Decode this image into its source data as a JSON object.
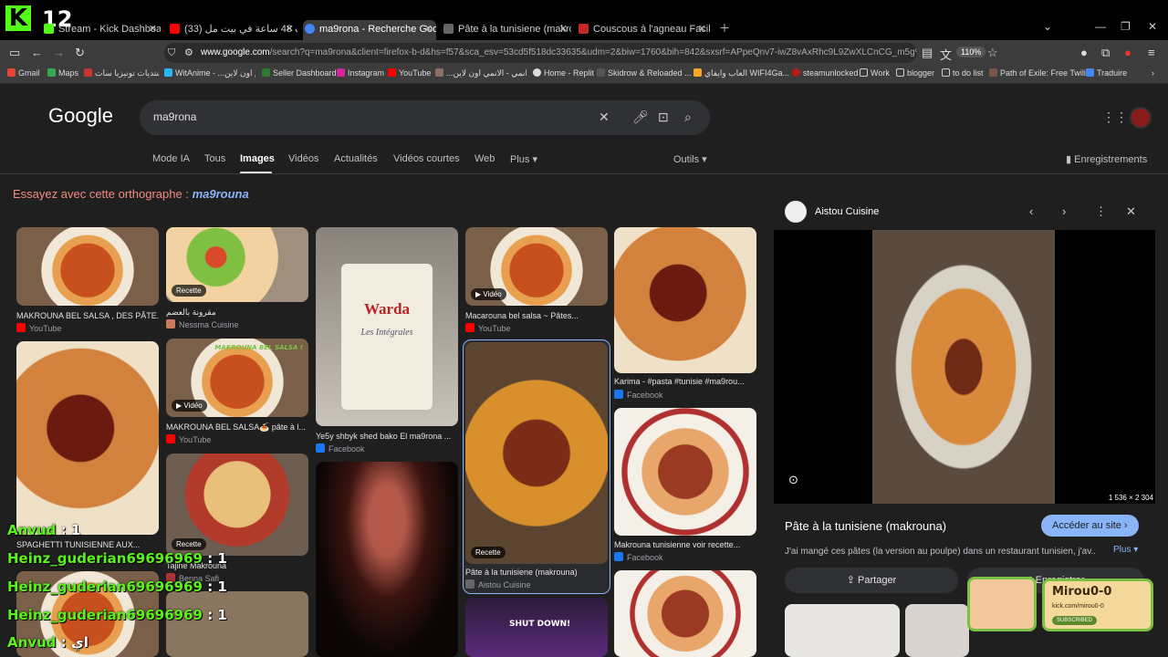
{
  "streamer": {
    "logo_letter": "K",
    "number": "12"
  },
  "tabs": [
    {
      "title": "Stream - Kick Dashboard",
      "color": "#53fc18"
    },
    {
      "title": "(33) عشت 48 ساعة في بيت مل...",
      "color": "#ff0000"
    },
    {
      "title": "ma9rona - Recherche Google",
      "color": "#4285f4"
    },
    {
      "title": "Pâte à la tunisiene (makrouna)",
      "color": "#666666"
    },
    {
      "title": "Couscous à l'agneau Facile et ra",
      "color": "#c62828"
    }
  ],
  "address": {
    "domain": "www.google.com",
    "rest": "/search?q=ma9rona&client=firefox-b-d&hs=f57&sca_esv=53cd5f518dc33635&udm=2&biw=1760&bih=842&sxsrf=APpeQnv7-iwZ8vAxRhc9L9ZwXLCnCG_m5g%3A178683447",
    "zoom": "110%"
  },
  "bookmarks": [
    "Gmail",
    "Maps",
    "منتديات تونيزيا سات",
    "WitAnime - ...م اون لاين",
    "Seller Dashboard",
    "Instagram",
    "YouTube",
    "...د انمي - الانمي اون لاين",
    "Home - Replit",
    "Skidrow & Reloaded ...",
    "العاب وايفاي WIFI4Ga...",
    "steamunlocked",
    "Work",
    "blogger",
    "to do list",
    "Path of Exile: Free Twili...",
    "Traduire"
  ],
  "google": {
    "logo": "Google",
    "query": "ma9rona"
  },
  "nav": [
    "Mode IA",
    "Tous",
    "Images",
    "Vidéos",
    "Actualités",
    "Vidéos courtes",
    "Web",
    "Plus"
  ],
  "tools": "Outils",
  "saved": "Enregistrements",
  "spell": {
    "prefix": "Essayez avec cette orthographe :",
    "suggestion": "ma9rouna"
  },
  "results": [
    {
      "caption": "MAKROUNA BEL SALSA , DES PÂTE...",
      "source": "YouTube"
    },
    {
      "caption": "مقرونة بالعضم",
      "source": "Nessma Cuisine",
      "badge": "Recette"
    },
    {
      "caption": "Ye5y shbyk shed bako El ma9rona ...",
      "source": "Facebook"
    },
    {
      "caption": "Macarouna bel salsa ~ Pâtes...",
      "source": "YouTube",
      "badge": "Vidéo"
    },
    {
      "caption": "Karima - #pasta #tunisie #ma9rou...",
      "source": "Facebook"
    },
    {
      "caption": "SPAGHETTI TUNISIENNE AUX...",
      "source": ""
    },
    {
      "caption": "MAKROUNA BEL SALSA🍝 pâte à l...",
      "source": "YouTube",
      "badge": "Vidéo"
    },
    {
      "caption": "Pâte à la tunisiene (makrouna)",
      "source": "Aistou Cuisine",
      "badge": "Recette"
    },
    {
      "caption": "Makrouna tunisienne voir recette...",
      "source": "Facebook"
    },
    {
      "caption": "Tajine Makrouna",
      "source": "Benna Safi",
      "badge": "Recette"
    }
  ],
  "overlay_text": {
    "warda": "Warda",
    "warda_sub": "Les Intégrales",
    "game": "SHUT DOWN!",
    "salsa": "MAKROUNA BEL SALSA !"
  },
  "panel": {
    "site": "Aistou Cuisine",
    "dims": "1 536 × 2 304",
    "title": "Pâte à la tunisiene (makrouna)",
    "visit": "Accéder au site",
    "desc": "J'ai mangé ces pâtes (la version au poulpe) dans un restaurant tunisien, j'av...",
    "more": "Plus",
    "share": "Partager",
    "save": "Enregistrer"
  },
  "chat": [
    {
      "user": "Anvud",
      "msg": ": 1"
    },
    {
      "user": "Heinz_guderian69696969",
      "msg": ": 1"
    },
    {
      "user": "Heinz_guderian69696969",
      "msg": ": 1"
    },
    {
      "user": "Heinz_guderian69696969",
      "msg": ": 1"
    },
    {
      "user": "Anvud",
      "msg": ": اي"
    }
  ],
  "kick_card": {
    "name": "Mirou0-0",
    "url": "kick.com/mirou0-0",
    "sub": "SUBSCRIBED"
  }
}
